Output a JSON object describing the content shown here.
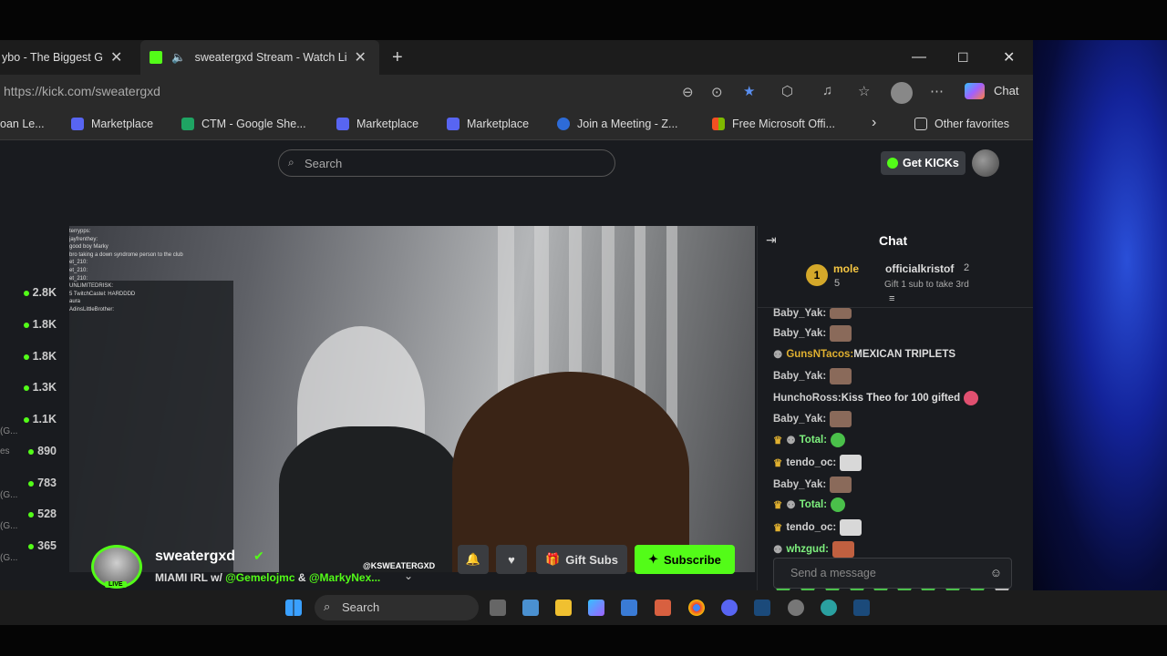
{
  "browser": {
    "tabs": [
      {
        "label": "ybo - The Biggest G",
        "close": "✕"
      },
      {
        "label": "sweatergxd Stream - Watch Li",
        "close": "✕"
      }
    ],
    "new_tab": "+",
    "url": "https://kick.com/sweatergxd",
    "chat_button": "Chat",
    "bookmarks": [
      "oan Le...",
      "Marketplace",
      "CTM - Google She...",
      "Marketplace",
      "Marketplace",
      "Join a Meeting - Z...",
      "Free Microsoft Offi...",
      "Other favorites"
    ],
    "bookmark_overflow": "›"
  },
  "kick": {
    "search_placeholder": "Search",
    "get_kicks": "Get KICKs",
    "sidebar_viewers": [
      "2.8K",
      "1.8K",
      "1.8K",
      "1.3K",
      "1.1K",
      "890",
      "783",
      "528",
      "365"
    ],
    "sidebar_snippets": [
      "(G...",
      "es",
      "(G...",
      "(G...",
      "(G..."
    ],
    "video_watermark": "@KSWEATERGXD",
    "overlay_chat": [
      "terrypps:",
      "jayfrenthey:",
      "good boy Marky",
      "bro taking a down syndrome person to the club",
      "et_210:",
      "et_210:",
      "et_210:",
      "UNLIMITEDRISK:",
      "5 TwitchCastel: HARDDDD",
      "aura",
      "AdinsLittleBrother:"
    ],
    "streamer": {
      "name": "sweatergxd",
      "live": "LIVE",
      "title_prefix": "MIAMI IRL w/ ",
      "mention1": "@Gemelojmc",
      "amp": " & ",
      "mention2": "@MarkyNex..."
    },
    "buttons": {
      "gift_subs": "Gift Subs",
      "subscribe": "Subscribe"
    },
    "chat": {
      "header": "Chat",
      "gifters": {
        "rank": "1",
        "name1": "mole",
        "count1": "5",
        "name2": "officialkristof",
        "count2": "2",
        "note": "Gift 1 sub to take 3rd"
      },
      "messages": [
        {
          "user": "Baby_Yak:",
          "text": ""
        },
        {
          "user": "Baby_Yak:",
          "text": ""
        },
        {
          "user": "GunsNTacos:",
          "text": " MEXICAN TRIPLETS"
        },
        {
          "user": "Baby_Yak:",
          "text": ""
        },
        {
          "user": "HunchoRoss:",
          "text": " Kiss Theo for 100 gifted"
        },
        {
          "user": "Baby_Yak:",
          "text": ""
        },
        {
          "user": "Total:",
          "text": ""
        },
        {
          "user": "tendo_oc:",
          "text": ""
        },
        {
          "user": "Baby_Yak:",
          "text": ""
        },
        {
          "user": "Total:",
          "text": ""
        },
        {
          "user": "tendo_oc:",
          "text": ""
        },
        {
          "user": "whzgud:",
          "text": ""
        }
      ],
      "input_placeholder": "Send a message"
    }
  },
  "taskbar": {
    "search": "Search"
  },
  "colors": {
    "kick_green": "#53fc18",
    "chat_bg": "#191b1f",
    "baby_yak": "#c8c8c8",
    "guns": "#e0b030",
    "huncho": "#cfcfcf",
    "total": "#7ef07e",
    "tendo": "#d0d0d0",
    "whzgud": "#7ef07e"
  }
}
